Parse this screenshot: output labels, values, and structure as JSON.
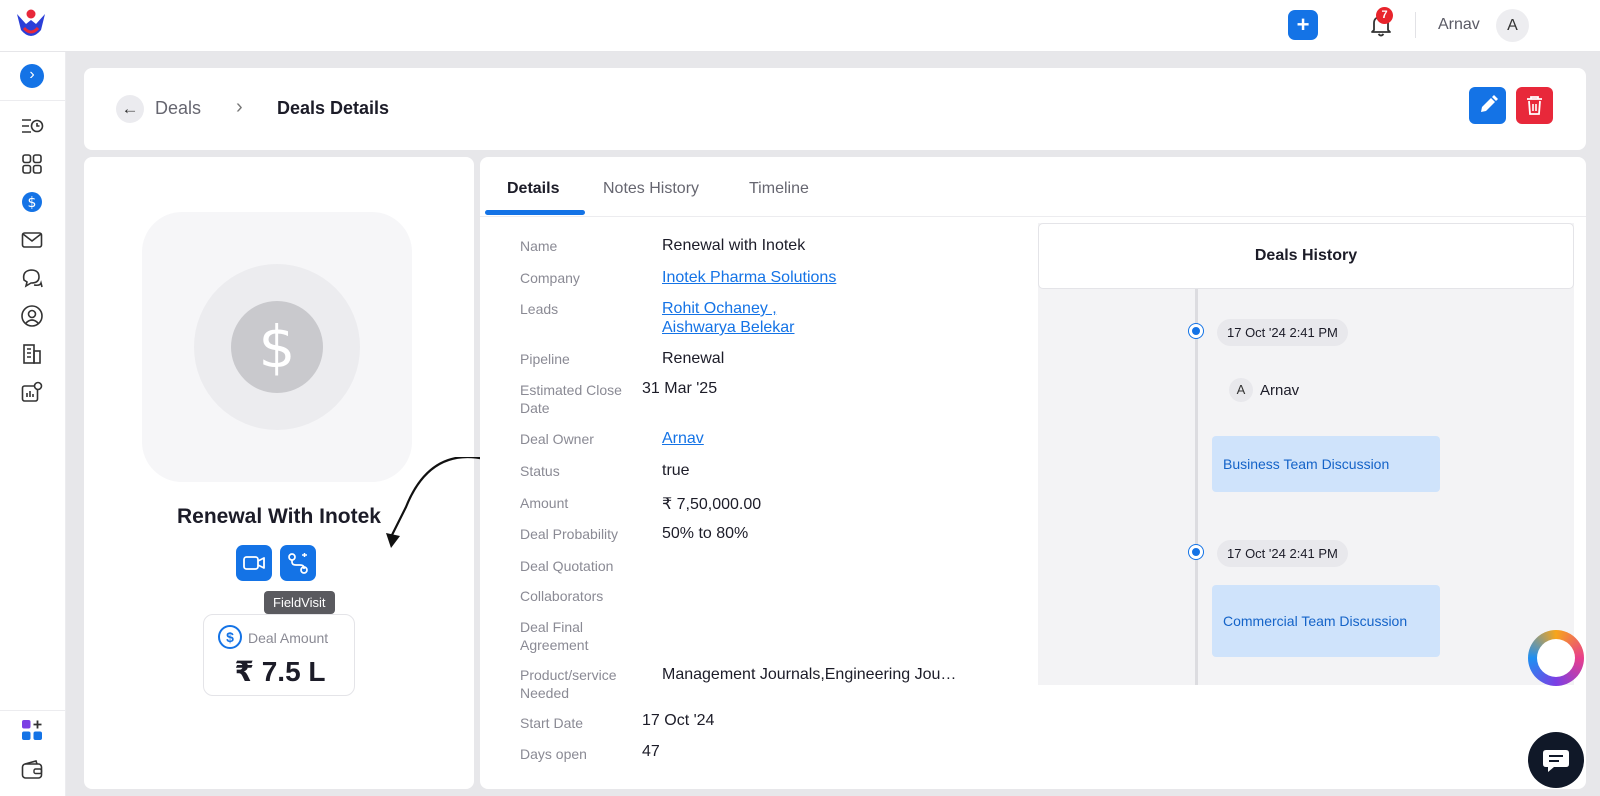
{
  "topbar": {
    "user_name": "Arnav",
    "user_initial": "A",
    "notification_count": "7"
  },
  "sidebar": {
    "items": [
      "toggle",
      "deals-list",
      "dashboard",
      "deals",
      "mail",
      "chat",
      "contacts",
      "companies",
      "reports",
      "apps",
      "wallet"
    ]
  },
  "breadcrumb": {
    "parent": "Deals",
    "current": "Deals Details"
  },
  "deal_card": {
    "title": "Renewal With Inotek",
    "tooltip": "FieldVisit",
    "amount_label": "Deal Amount",
    "amount_value": "₹ 7.5 L"
  },
  "tabs": [
    "Details",
    "Notes History",
    "Timeline"
  ],
  "details": {
    "name_label": "Name",
    "name_value": "Renewal with Inotek",
    "company_label": "Company",
    "company_value": "Inotek Pharma Solutions",
    "leads_label": "Leads",
    "leads_value_1": "Rohit Ochaney ,",
    "leads_value_2": "Aishwarya Belekar",
    "pipeline_label": "Pipeline",
    "pipeline_value": "Renewal",
    "close_label": "Estimated Close Date",
    "close_value": "31 Mar '25",
    "owner_label": "Deal Owner",
    "owner_value": "Arnav",
    "status_label": "Status",
    "status_value": "true",
    "amount_label": "Amount",
    "amount_value": "₹ 7,50,000.00",
    "probability_label": "Deal Probability",
    "probability_value": "50% to 80%",
    "quotation_label": "Deal Quotation",
    "collaborators_label": "Collaborators",
    "agreement_label": "Deal Final Agreement",
    "product_label": "Product/service Needed",
    "product_value": "Management Journals,Engineering Jou…",
    "start_label": "Start Date",
    "start_value": "17 Oct '24",
    "days_label": "Days open",
    "days_value": "47"
  },
  "history": {
    "title": "Deals History",
    "entries": [
      {
        "time": "17 Oct '24 2:41 PM",
        "user_initial": "A",
        "user": "Arnav",
        "note": "Business Team Discussion"
      },
      {
        "time": "17 Oct '24 2:41 PM",
        "note": "Commercial Team Discussion"
      }
    ]
  },
  "colors": {
    "accent": "#1473e6",
    "danger": "#e8283a",
    "history_box": "#cfe3fb"
  }
}
